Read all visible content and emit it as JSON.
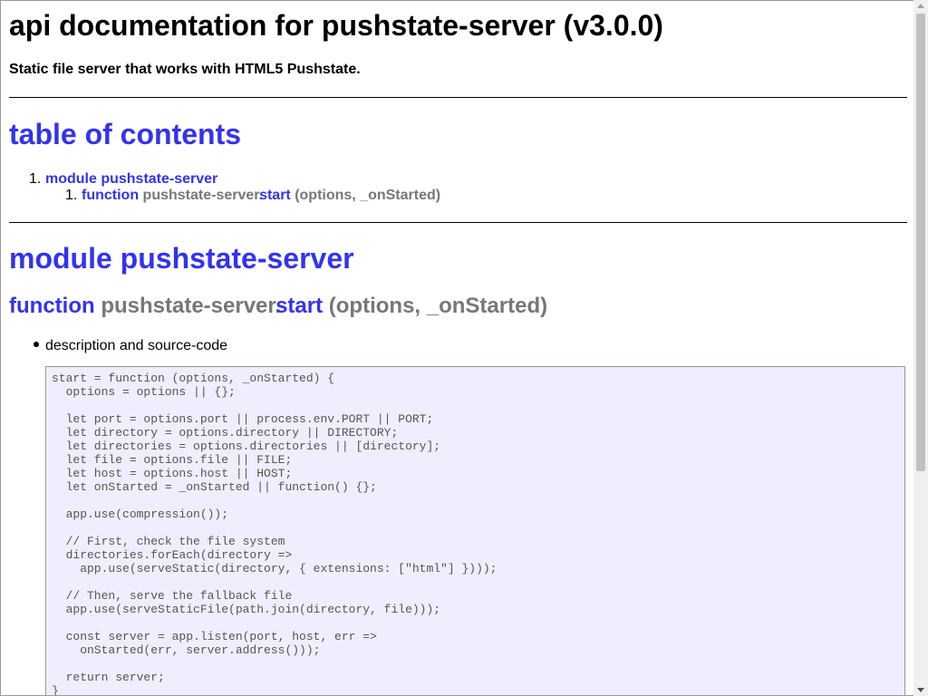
{
  "header": {
    "title": "api documentation for pushstate-server (v3.0.0)",
    "subtitle": "Static file server that works with HTML5 Pushstate."
  },
  "toc": {
    "heading": "table of contents",
    "items": [
      {
        "number": "1.",
        "label": "module pushstate-server"
      }
    ],
    "subitems": [
      {
        "number": "1.",
        "keyword": "function",
        "prefix": "pushstate-server.",
        "name": "start",
        "args": "(options, _onStarted)"
      }
    ]
  },
  "module": {
    "heading": "module pushstate-server",
    "function": {
      "keyword": "function",
      "prefix": "pushstate-server.",
      "name": "start",
      "args": "(options, _onStarted)"
    },
    "bullet_label": "description and source-code",
    "code": "start = function (options, _onStarted) {\n  options = options || {};\n\n  let port = options.port || process.env.PORT || PORT;\n  let directory = options.directory || DIRECTORY;\n  let directories = options.directories || [directory];\n  let file = options.file || FILE;\n  let host = options.host || HOST;\n  let onStarted = _onStarted || function() {};\n\n  app.use(compression());\n\n  // First, check the file system\n  directories.forEach(directory =>\n    app.use(serveStatic(directory, { extensions: [\"html\"] })));\n\n  // Then, serve the fallback file\n  app.use(serveStaticFile(path.join(directory, file)));\n\n  const server = app.listen(port, host, err =>\n    onStarted(err, server.address()));\n\n  return server;\n}"
  },
  "colors": {
    "link": "#3333ee",
    "muted": "#777777",
    "code_bg": "#eeeeff"
  }
}
